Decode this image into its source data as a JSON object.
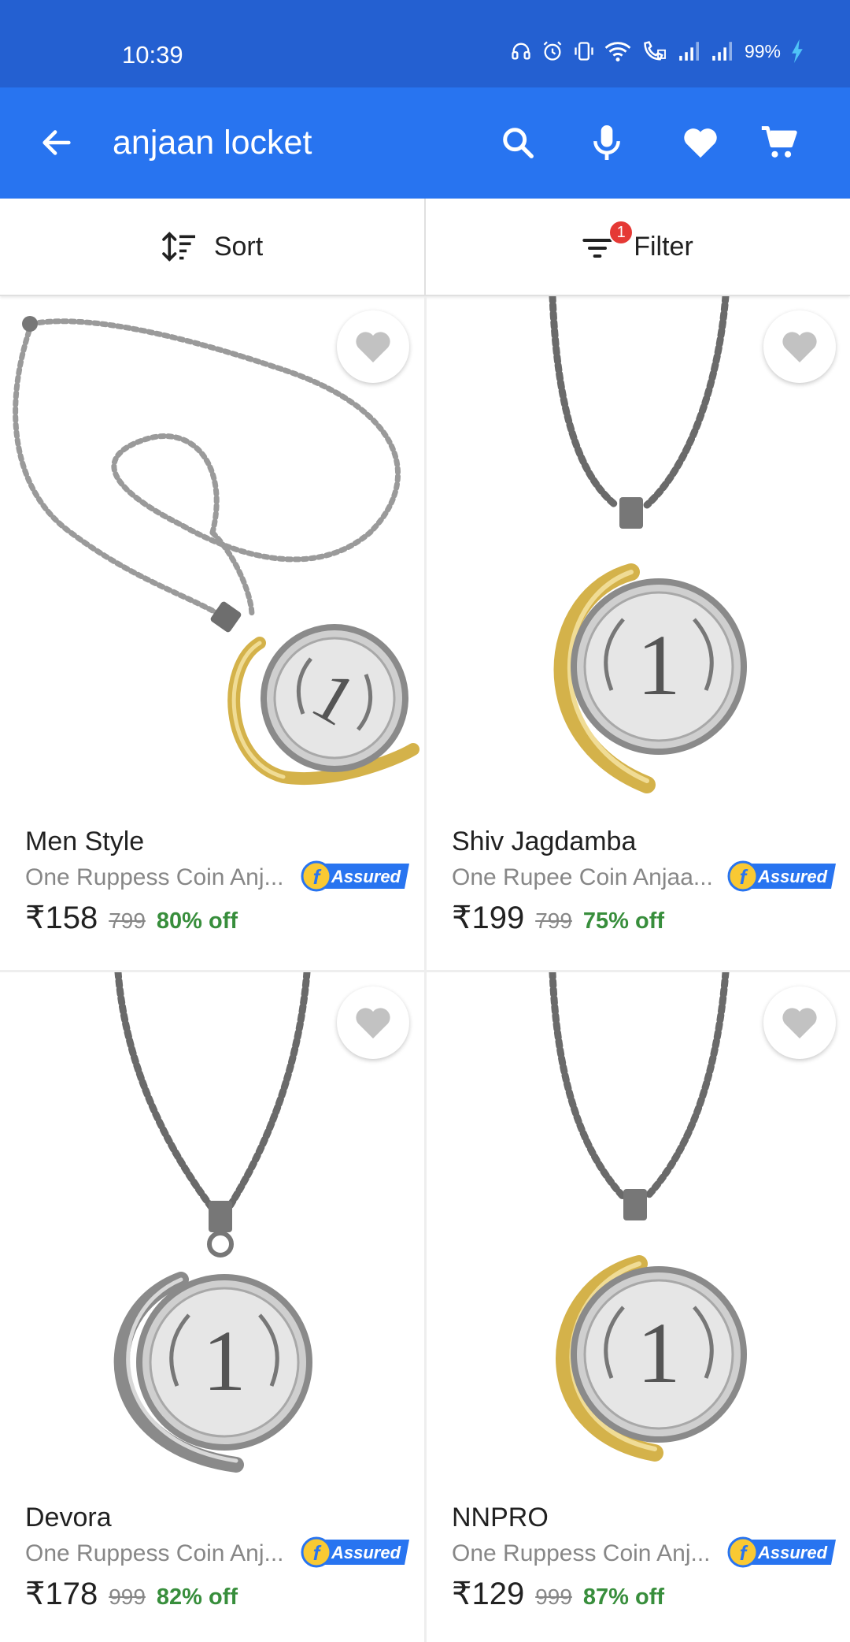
{
  "status_bar": {
    "time": "10:39",
    "battery": "99%"
  },
  "app_bar": {
    "query": "anjaan locket",
    "icons": [
      "back-arrow-icon",
      "search-icon",
      "microphone-icon",
      "heart-icon",
      "cart-icon"
    ]
  },
  "toolbar": {
    "sort_label": "Sort",
    "filter_label": "Filter",
    "filter_count": "1"
  },
  "products": [
    {
      "brand": "Men Style",
      "title": "One Ruppess Coin Anj...",
      "price": "₹158",
      "mrp": "799",
      "discount": "80% off",
      "assured_label": "Assured"
    },
    {
      "brand": "Shiv Jagdamba",
      "title": "One Rupee Coin Anjaa...",
      "price": "₹199",
      "mrp": "799",
      "discount": "75% off",
      "assured_label": "Assured"
    },
    {
      "brand": "Devora",
      "title": "One Ruppess Coin Anj...",
      "price": "₹178",
      "mrp": "999",
      "discount": "82% off",
      "assured_label": "Assured"
    },
    {
      "brand": "NNPRO",
      "title": "One Ruppess Coin Anj...",
      "price": "₹129",
      "mrp": "999",
      "discount": "87% off",
      "assured_label": "Assured"
    }
  ],
  "colors": {
    "status_bar": "#2460d1",
    "app_bar": "#2874f0",
    "discount": "#388e3c",
    "badge": "#e53935",
    "gold": "#d4b24a"
  }
}
